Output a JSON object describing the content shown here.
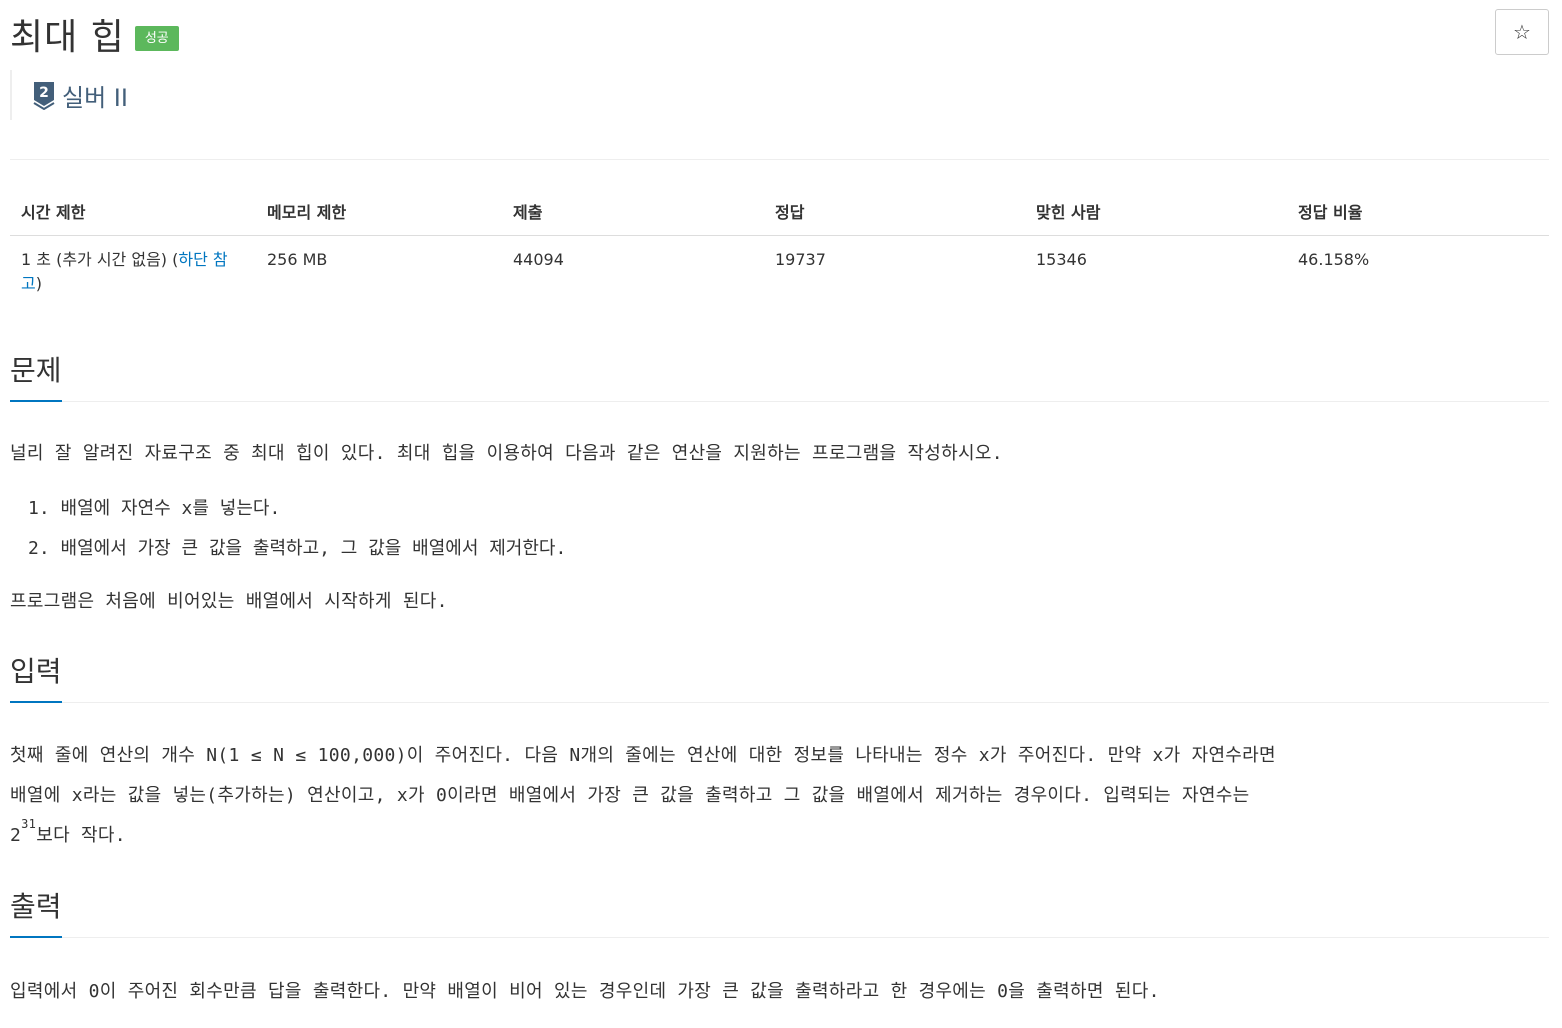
{
  "problem": {
    "title": "최대 힙",
    "status_badge": "성공",
    "star_glyph": "☆",
    "tier": {
      "number": "2",
      "label": "실버 II",
      "color": "#435f7a"
    }
  },
  "info_table": {
    "headers": {
      "time_limit": "시간 제한",
      "memory_limit": "메모리 제한",
      "submissions": "제출",
      "accepted": "정답",
      "solved_users": "맞힌 사람",
      "accepted_ratio": "정답 비율"
    },
    "values": {
      "time_limit": "1 초 (추가 시간 없음) (",
      "time_limit_link": "하단 참고",
      "time_limit_tail": ")",
      "memory_limit": "256 MB",
      "submissions": "44094",
      "accepted": "19737",
      "solved_users": "15346",
      "accepted_ratio": "46.158%"
    }
  },
  "sections": {
    "description": {
      "title": "문제",
      "intro": "널리 잘 알려진 자료구조 중 최대 힙이 있다. 최대 힙을 이용하여 다음과 같은 연산을 지원하는 프로그램을 작성하시오.",
      "items": [
        "1. 배열에 자연수 x를 넣는다.",
        "2. 배열에서 가장 큰 값을 출력하고, 그 값을 배열에서 제거한다."
      ],
      "outro": "프로그램은 처음에 비어있는 배열에서 시작하게 된다."
    },
    "input": {
      "title": "입력",
      "line1": "첫째 줄에 연산의 개수 N(1 ≤ N ≤ 100,000)이 주어진다. 다음 N개의 줄에는 연산에 대한 정보를 나타내는 정수 x가 주어진다. 만약 x가 자연수라면",
      "line2": "배열에 x라는 값을 넣는(추가하는) 연산이고, x가 0이라면 배열에서 가장 큰 값을 출력하고 그 값을 배열에서 제거하는 경우이다. 입력되는 자연수는",
      "line3_base": "2",
      "line3_sup": "31",
      "line3_rest": "보다 작다."
    },
    "output": {
      "title": "출력",
      "text": "입력에서 0이 주어진 회수만큼 답을 출력한다. 만약 배열이 비어 있는 경우인데 가장 큰 값을 출력하라고 한 경우에는 0을 출력하면 된다."
    }
  },
  "colors": {
    "link": "#0076c0",
    "success": "#5cb85c",
    "text": "#333333"
  }
}
